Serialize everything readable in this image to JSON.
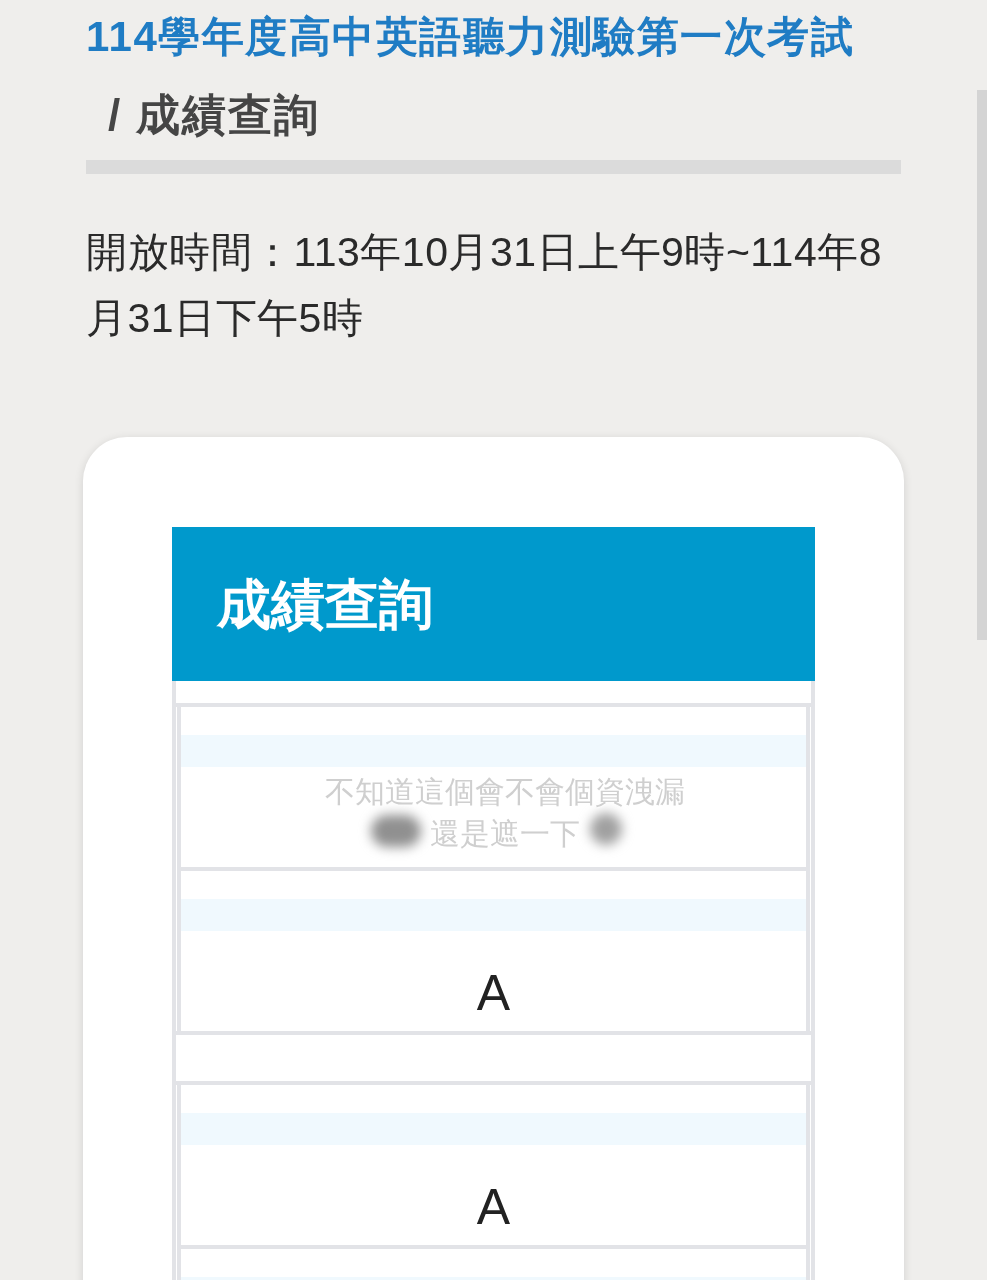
{
  "page": {
    "title": "114學年度高中英語聽力測驗第一次考試",
    "subtitle": "/ 成績查詢",
    "open_time": "開放時間：113年10月31日上午9時~114年8月31日下午5時"
  },
  "score_card": {
    "header": "成績查詢",
    "groups": [
      {
        "rows": [
          {
            "kind": "redacted",
            "annotation": [
              "不知道這個會不會個資洩漏",
              "還是遮一下"
            ]
          },
          {
            "kind": "grade",
            "value": "A"
          }
        ]
      },
      {
        "rows": [
          {
            "kind": "grade",
            "value": "A"
          },
          {
            "kind": "blank"
          }
        ]
      }
    ]
  }
}
